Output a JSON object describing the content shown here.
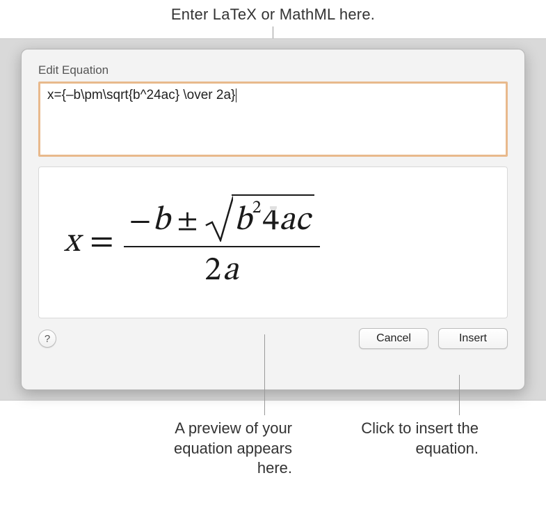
{
  "callouts": {
    "top": "Enter LaTeX or MathML here.",
    "preview": "A preview of your equation appears here.",
    "insert": "Click to insert the equation."
  },
  "dialog": {
    "title": "Edit Equation",
    "input_value": "x={–b\\pm\\sqrt{b^24ac} \\over 2a}",
    "help_label": "?",
    "cancel_label": "Cancel",
    "insert_label": "Insert"
  },
  "equation_preview": {
    "lhs_var": "x",
    "equals": "=",
    "numerator_minus": "−",
    "numerator_b": "b",
    "plus_minus": "±",
    "radicand_b": "b",
    "radicand_exp": "2",
    "radicand_4": "4",
    "radicand_a": "a",
    "radicand_c": "c",
    "denominator_2": "2",
    "denominator_a": "a"
  }
}
